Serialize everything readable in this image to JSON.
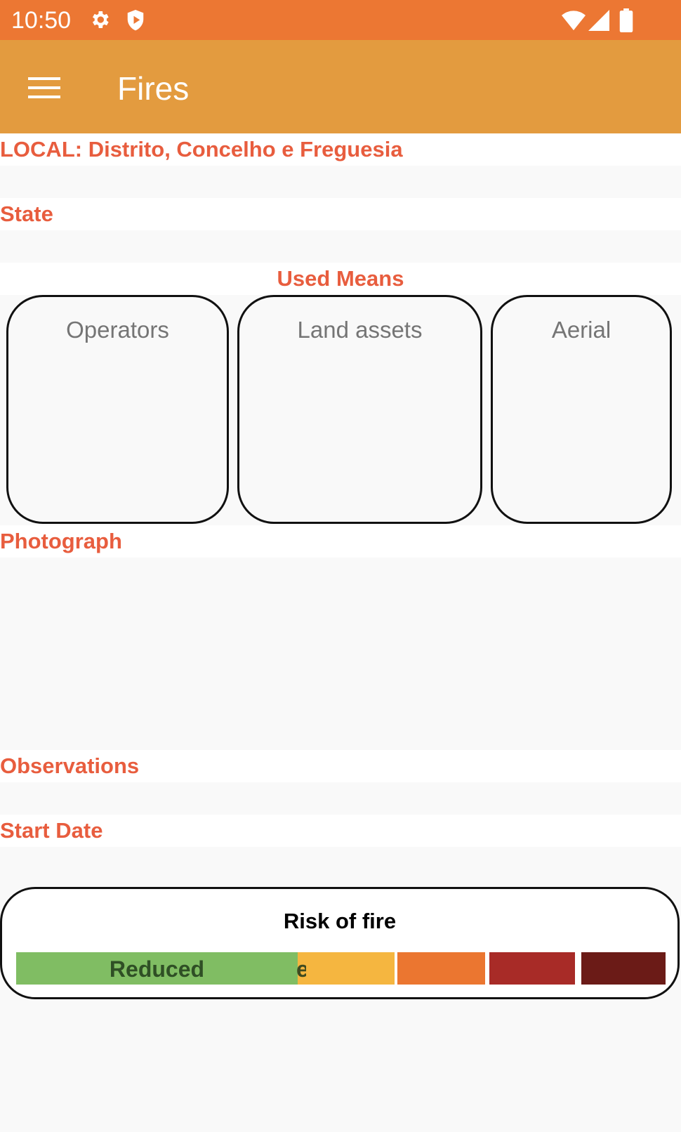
{
  "status_bar": {
    "time": "10:50",
    "icons": [
      "gear-icon",
      "shield-play-icon",
      "wifi-icon",
      "cellular-signal-icon",
      "battery-icon"
    ]
  },
  "app_bar": {
    "title": "Fires",
    "menu_icon": "hamburger-menu-icon"
  },
  "fields": {
    "local_label": "LOCAL: Distrito, Concelho e Freguesia",
    "local_value": "",
    "state_label": "State",
    "state_value": "",
    "used_means_label": "Used Means",
    "photograph_label": "Photograph",
    "observations_label": "Observations",
    "observations_value": "",
    "start_date_label": "Start Date",
    "start_date_value": ""
  },
  "used_means": {
    "operators": "Operators",
    "land_assets": "Land assets",
    "aerial": "Aerial"
  },
  "risk": {
    "title": "Risk of fire",
    "selected_label": "Reduced",
    "hidden_label_fragment": "e",
    "levels": [
      {
        "color": "#80bd63"
      },
      {
        "color": "#f5b640"
      },
      {
        "color": "#eb7630"
      },
      {
        "color": "#a82b27"
      },
      {
        "color": "#6b1b17"
      }
    ]
  },
  "colors": {
    "status_bar": "#ec7733",
    "app_bar": "#e39b3f",
    "label_text": "#e85d3e",
    "background": "#f9f9f9"
  }
}
